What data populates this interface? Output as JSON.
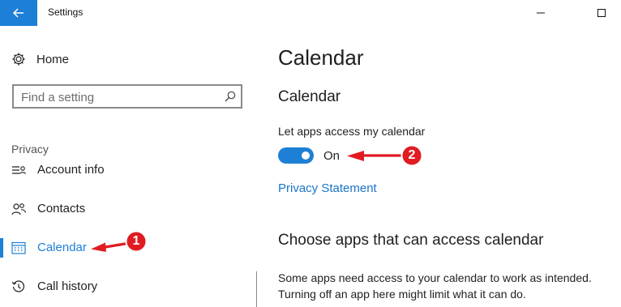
{
  "window": {
    "title": "Settings"
  },
  "sidebar": {
    "home_label": "Home",
    "search_placeholder": "Find a setting",
    "section_label": "Privacy",
    "items": [
      {
        "label": "Account info",
        "icon": "account-info-icon"
      },
      {
        "label": "Contacts",
        "icon": "contacts-icon"
      },
      {
        "label": "Calendar",
        "icon": "calendar-icon",
        "selected": true
      },
      {
        "label": "Call history",
        "icon": "history-icon"
      }
    ]
  },
  "main": {
    "page_title": "Calendar",
    "section_title": "Calendar",
    "toggle_caption": "Let apps access my calendar",
    "toggle_state": "On",
    "privacy_link": "Privacy Statement",
    "section2_title": "Choose apps that can access calendar",
    "description_line1": "Some apps need access to your calendar to work as intended.",
    "description_line2": "Turning off an app here might limit what it can do."
  },
  "annotations": {
    "marker_1": "1",
    "marker_2": "2"
  },
  "colors": {
    "accent": "#1e7fd6",
    "link": "#1a74c9",
    "annotation_red": "#e01b22"
  }
}
